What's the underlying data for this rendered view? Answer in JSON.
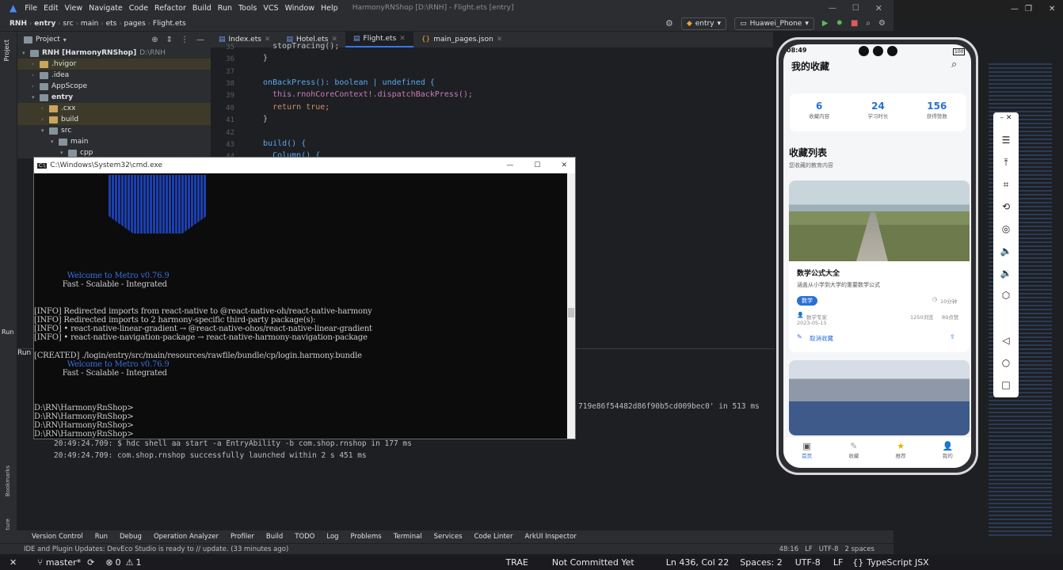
{
  "window": {
    "title": "HarmonyRNShop [D:\\RNH] - Flight.ets [entry]",
    "menu": [
      "File",
      "Edit",
      "View",
      "Navigate",
      "Code",
      "Refactor",
      "Build",
      "Run",
      "Tools",
      "VCS",
      "Window",
      "Help"
    ]
  },
  "breadcrumb": [
    "RNH",
    "entry",
    "src",
    "main",
    "ets",
    "pages",
    "Flight.ets"
  ],
  "run_config": "entry",
  "device": "Huawei_Phone",
  "project": {
    "header": "Project",
    "items": [
      {
        "label": "RNH [HarmonyRNShop]",
        "extra": "D:\\RNH"
      },
      {
        "label": ".hvigor"
      },
      {
        "label": ".idea"
      },
      {
        "label": "AppScope"
      },
      {
        "label": "entry"
      },
      {
        "label": ".cxx"
      },
      {
        "label": "build"
      },
      {
        "label": "src"
      },
      {
        "label": "main"
      },
      {
        "label": "cpp"
      }
    ]
  },
  "tabs": [
    "Index.ets",
    "Hotel.ets",
    "Flight.ets",
    "main_pages.json"
  ],
  "code": [
    {
      "n": "35",
      "t": "    stopTracing();"
    },
    {
      "n": "36",
      "t": "  }"
    },
    {
      "n": "37",
      "t": ""
    },
    {
      "n": "38",
      "t": "  onBackPress(): boolean | undefined {"
    },
    {
      "n": "39",
      "t": "    this.rnohCoreContext!.dispatchBackPress();"
    },
    {
      "n": "40",
      "t": "    return true;"
    },
    {
      "n": "41",
      "t": "  }"
    },
    {
      "n": "42",
      "t": ""
    },
    {
      "n": "43",
      "t": "  build() {"
    },
    {
      "n": "44",
      "t": "    Column() {"
    }
  ],
  "run_log": [
    "719e86f54482d86f90b5cd009bec0' in 513 ms",
    "20:49:24.709: $ hdc shell aa start -a EntryAbility -b com.shop.rnshop in 177 ms",
    "20:49:24.709: com.shop.rnshop successfully launched within 2 s 451 ms"
  ],
  "run_label": "Run",
  "cmd": {
    "title": "C:\\Windows\\System32\\cmd.exe",
    "lines": [
      "              Welcome to Metro v0.76.9",
      "            Fast - Scalable - Integrated",
      "",
      "",
      "[INFO] Redirected imports from react-native to @react-native-oh/react-native-harmony",
      "[INFO] Redirected imports to 2 harmony-specific third-party package(s):",
      "[INFO] • react-native-linear-gradient → @react-native-ohos/react-native-linear-gradient",
      "[INFO] • react-native-navigation-package → react-native-harmony-navigation-package",
      "",
      "[CREATED] ./login/entry/src/main/resources/rawfile/bundle/cp/login.harmony.bundle",
      "              Welcome to Metro v0.76.9",
      "            Fast - Scalable - Integrated",
      "",
      "",
      "D:\\RN\\HarmonyRnShop>",
      "D:\\RN\\HarmonyRnShop>",
      "D:\\RN\\HarmonyRnShop>",
      "D:\\RN\\HarmonyRnShop>"
    ]
  },
  "tool_windows": [
    "Version Control",
    "Run",
    "Debug",
    "Operation Analyzer",
    "Profiler",
    "Build",
    "TODO",
    "Log",
    "Problems",
    "Terminal",
    "Services",
    "Code Linter",
    "ArkUI Inspector"
  ],
  "status": {
    "message": "IDE and Plugin Updates: DevEco Studio is ready to // update. (33 minutes ago)",
    "pos": "48:16",
    "lf": "LF",
    "enc": "UTF-8",
    "indent": "2 spaces"
  },
  "taskbar": {
    "branch": "master*",
    "errors": "0",
    "warnings": "1",
    "trae": "TRAE",
    "commit": "Not Committed Yet",
    "ln": "Ln 436, Col 22",
    "spaces": "Spaces: 2",
    "enc": "UTF-8",
    "lf": "LF",
    "lang": "TypeScript JSX"
  },
  "phone": {
    "time": "08:49",
    "battery": "100",
    "title": "我的收藏",
    "stats": [
      {
        "value": "6",
        "label": "收藏内容"
      },
      {
        "value": "24",
        "label": "学习时长"
      },
      {
        "value": "156",
        "label": "获得赞数"
      }
    ],
    "section_title": "收藏列表",
    "section_sub": "您收藏的教育内容",
    "card": {
      "title": "数学公式大全",
      "desc": "涵盖从小学到大学的重要数学公式",
      "tag": "数学",
      "duration": "10分钟",
      "author": "数学专家",
      "date": "2023-05-15",
      "views": "1250浏览",
      "likes": "89点赞",
      "action": "取消收藏"
    },
    "nav": [
      "首页",
      "收藏",
      "推荐",
      "我的"
    ],
    "colors": {
      "accent": "#2b6fd6",
      "active": "#2b6fd6"
    }
  }
}
